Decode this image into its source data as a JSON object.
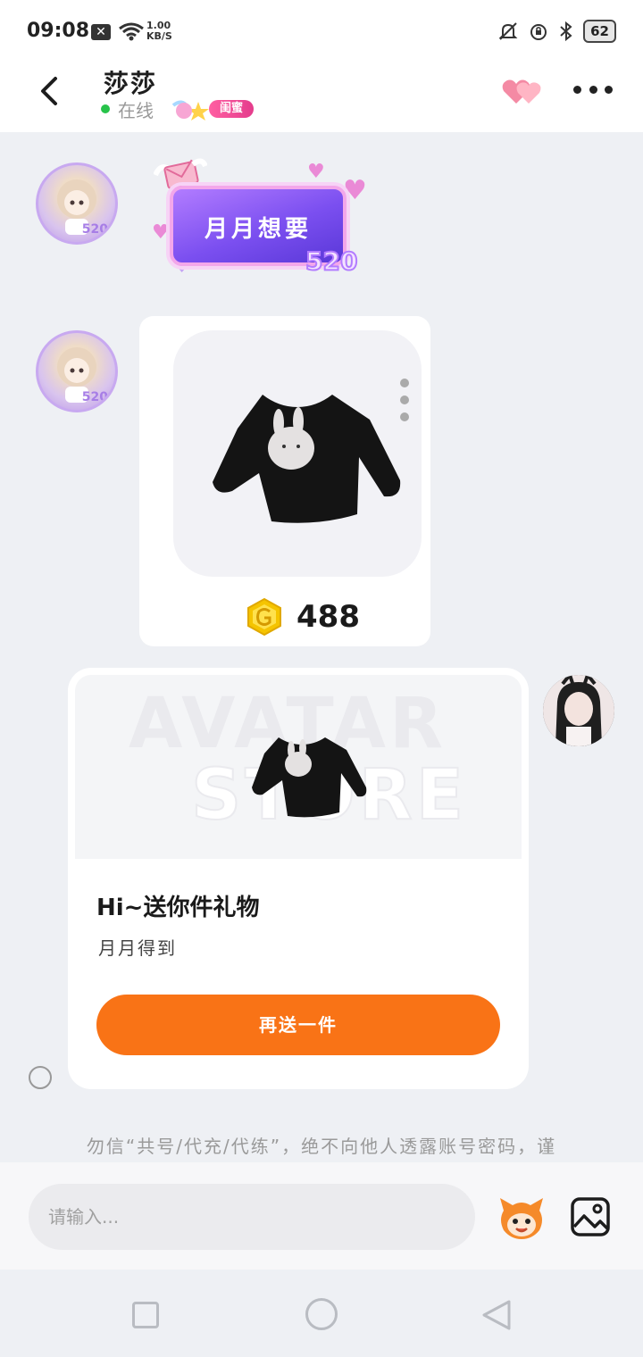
{
  "status_bar": {
    "time": "09:08",
    "network_speed_value": "1.00",
    "network_speed_unit": "KB/S",
    "battery": "62",
    "icons": [
      "x-notification-icon",
      "wifi-icon",
      "bell-muted-icon",
      "alarm-icon",
      "bluetooth-icon",
      "battery-icon"
    ]
  },
  "header": {
    "contact_name": "莎莎",
    "online_status": "在线",
    "relationship_tag": "闺蜜",
    "status_color": "#27c34a",
    "icons": [
      "back-arrow-icon",
      "hearts-icon",
      "more-dots-icon"
    ]
  },
  "messages": {
    "wish_card": {
      "text": "月月想要",
      "badge_number": "520"
    },
    "product_card": {
      "price": "488",
      "coin_color": "#f2c400"
    },
    "gift_card": {
      "watermark_line1": "AVATAR",
      "watermark_line2": "STORE",
      "title": "Hi~送你件礼物",
      "subtitle": "月月得到",
      "button_label": "再送一件",
      "button_color": "#f97316"
    },
    "avatar_badge": "520"
  },
  "notice": "勿信“共号/代充/代练”，绝不向他人透露账号密码，谨",
  "input_bar": {
    "placeholder": "请输入...",
    "icons": [
      "emoji-mascot-icon",
      "image-gallery-icon"
    ]
  },
  "nav_bar": {
    "icons": [
      "recent-apps-square-icon",
      "home-circle-icon",
      "back-triangle-icon"
    ]
  }
}
